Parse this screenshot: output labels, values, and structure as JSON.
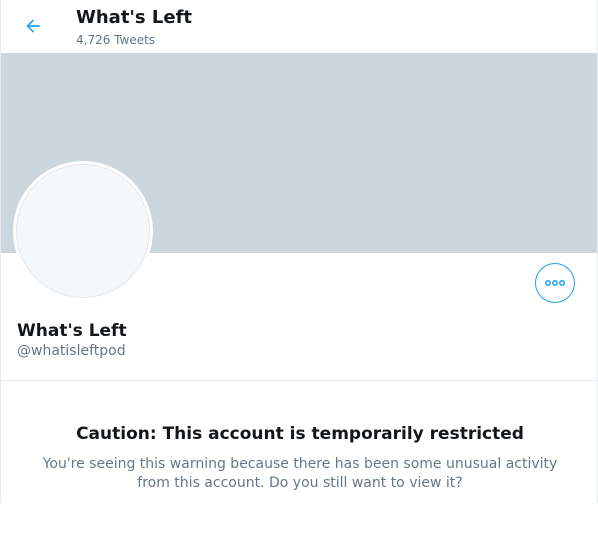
{
  "header": {
    "title": "What's Left",
    "tweet_count": "4,726 Tweets",
    "back_icon": "arrow-left-icon"
  },
  "profile": {
    "display_name": "What's Left",
    "handle": "@whatisleftpod",
    "more_icon": "more-horizontal-icon"
  },
  "caution": {
    "title": "Caution: This account is temporarily restricted",
    "message": "You're seeing this warning because there has been some unusual activity from this account. Do you still want to view it?"
  },
  "colors": {
    "accent": "#1da1f2",
    "banner": "#ccd6dd",
    "text_primary": "#14171a",
    "text_secondary": "#657786"
  }
}
